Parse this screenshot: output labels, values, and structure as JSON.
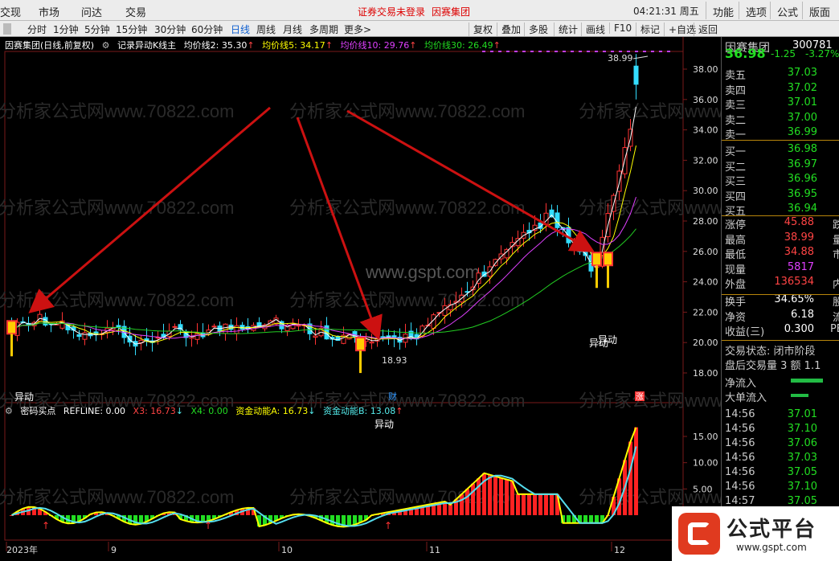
{
  "menubar": {
    "items": [
      "交现",
      "市场",
      "问达",
      "交易"
    ],
    "warning": "证券交易未登录",
    "brand": "因赛集团",
    "time": "04:21:31 周五",
    "right_buttons": [
      "功能",
      "选项",
      "公式",
      "版面"
    ]
  },
  "periods": {
    "items": [
      "分时",
      "1分钟",
      "5分钟",
      "15分钟",
      "30分钟",
      "60分钟",
      "日线",
      "周线",
      "月线",
      "多周期",
      "更多>"
    ],
    "active": "日线"
  },
  "toolbar": {
    "items": [
      "复权",
      "叠加",
      "多股",
      "统计",
      "画线",
      "F10",
      "标记",
      "+自选",
      "返回"
    ]
  },
  "stock": {
    "name": "因赛集团",
    "code": "300781",
    "price": "36.98",
    "change": "-1.25",
    "pct": "-3.27%"
  },
  "main_info": {
    "title": "因赛集团(日线,前复权)",
    "formula": "记录异动K线主",
    "ma2": "均价线2: 35.30",
    "ma5": "均价线5: 34.17",
    "ma10": "均价线10: 29.76",
    "ma30": "均价线30: 26.49"
  },
  "sub_info": {
    "name": "密码买点",
    "refline": "REFLINE: 0.00",
    "x3": "X3: 16.73",
    "x4": "X4: 0.00",
    "fa": "资金动能A: 16.73",
    "fb": "资金动能B: 13.08"
  },
  "orderbook": [
    {
      "label": "卖五",
      "value": "37.03"
    },
    {
      "label": "卖四",
      "value": "37.02"
    },
    {
      "label": "卖三",
      "value": "37.01"
    },
    {
      "label": "卖二",
      "value": "37.00"
    },
    {
      "label": "卖一",
      "value": "36.99"
    },
    {
      "label": "买一",
      "value": "36.98"
    },
    {
      "label": "买二",
      "value": "36.97"
    },
    {
      "label": "买三",
      "value": "36.96"
    },
    {
      "label": "买四",
      "value": "36.95"
    },
    {
      "label": "买五",
      "value": "36.94"
    }
  ],
  "stats": [
    {
      "label": "涨停",
      "value": "45.88",
      "extra": "跌",
      "color": "#ff4444"
    },
    {
      "label": "最高",
      "value": "38.99",
      "extra": "量",
      "color": "#ff4444"
    },
    {
      "label": "最低",
      "value": "34.88",
      "extra": "市",
      "color": "#ff4444"
    },
    {
      "label": "现量",
      "value": "5817",
      "extra": "",
      "color": "#e040ff"
    },
    {
      "label": "外盘",
      "value": "136534",
      "extra": "内",
      "color": "#ff4444"
    },
    {
      "label": "换手",
      "value": "34.65%",
      "extra": "股",
      "color": "#ffffff"
    },
    {
      "label": "净资",
      "value": "6.18",
      "extra": "流",
      "color": "#ffffff"
    },
    {
      "label": "收益(三)",
      "value": "0.300",
      "extra": "PE",
      "color": "#ffffff"
    }
  ],
  "status": {
    "state": "交易状态: 闭市阶段",
    "after": "盘后交易量 3 额 1.1",
    "netflow": "净流入",
    "bigflow": "大单流入"
  },
  "ticks": [
    {
      "t": "14:56",
      "p": "37.01"
    },
    {
      "t": "14:56",
      "p": "37.10"
    },
    {
      "t": "14:56",
      "p": "37.06"
    },
    {
      "t": "14:56",
      "p": "37.03"
    },
    {
      "t": "14:56",
      "p": "37.05"
    },
    {
      "t": "14:56",
      "p": "37.10"
    },
    {
      "t": "14:57",
      "p": "37.05"
    }
  ],
  "labels": {
    "yidong": "异动",
    "low": "18.93",
    "high": "38.99",
    "cai": "财",
    "zhang": "涨"
  },
  "axis": {
    "main_ticks": [
      "38.00",
      "36.00",
      "34.00",
      "32.00",
      "30.00",
      "28.00",
      "26.00",
      "24.00",
      "22.00",
      "20.00",
      "18.00"
    ],
    "sub_ticks": [
      "15.00",
      "10.00",
      "5.00"
    ],
    "dates": [
      "2023年",
      "9",
      "10",
      "11",
      "12"
    ]
  },
  "watermark": {
    "text": "分析家公式网www.70822.com",
    "site": "www.gspt.com",
    "logo": "公式平台",
    "logo_url": "www.gspt.com"
  },
  "colors": {
    "up": "#ff3333",
    "down": "#33ddff",
    "ma2": "#ffffff",
    "ma5": "#ffff00",
    "ma10": "#e040ff",
    "ma30": "#22cc22",
    "arrow": "#cc1111"
  }
}
